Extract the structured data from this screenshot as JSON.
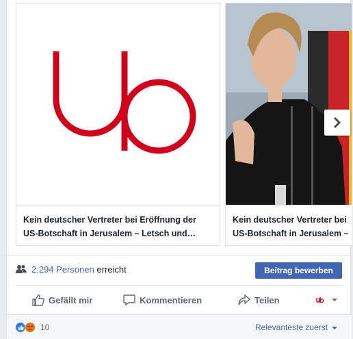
{
  "cards": [
    {
      "line1": "Kein deutscher Vertreter bei Eröffnung der",
      "line2": "US-Botschaft in Jerusalem – Letsch und…",
      "image": "ub-logo"
    },
    {
      "line1": "Kein deutscher Vertreter bei",
      "line2": "US-Botschaft in Jerusalem – ",
      "image": "photo-speaker-podium"
    }
  ],
  "reach": {
    "number": "2.294 Personen",
    "suffix": " erreicht"
  },
  "boost_label": "Beitrag bewerben",
  "actions": {
    "like": "Gefällt mir",
    "comment": "Kommentieren",
    "share": "Teilen"
  },
  "reactions": {
    "count": "10"
  },
  "sort_label": "Relevanteste zuerst",
  "colors": {
    "accent": "#4267b2",
    "logo_red": "#d0021b"
  }
}
